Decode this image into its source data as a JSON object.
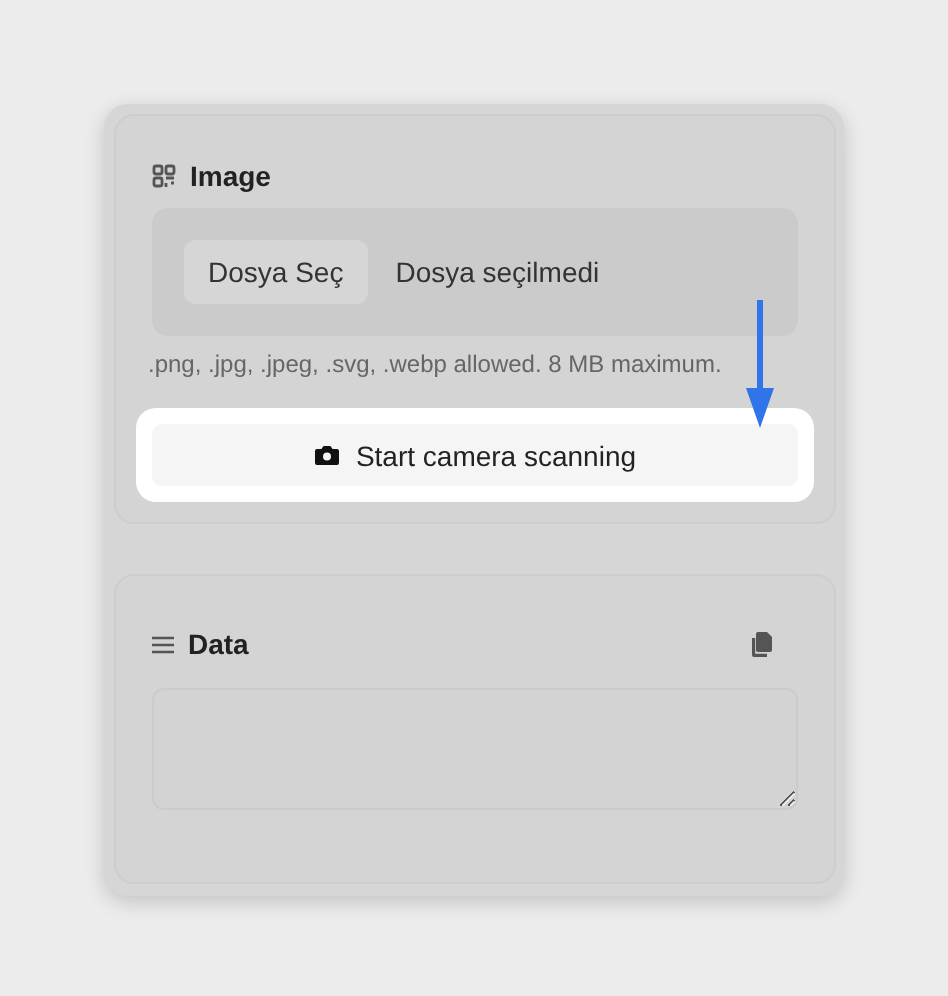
{
  "image_section": {
    "title": "Image",
    "file_button": "Dosya Seç",
    "file_status": "Dosya seçilmedi",
    "hint": ".png, .jpg, .jpeg, .svg, .webp allowed. 8 MB maximum.",
    "scan_button": "Start camera scanning",
    "highlighted": true
  },
  "data_section": {
    "title": "Data"
  }
}
